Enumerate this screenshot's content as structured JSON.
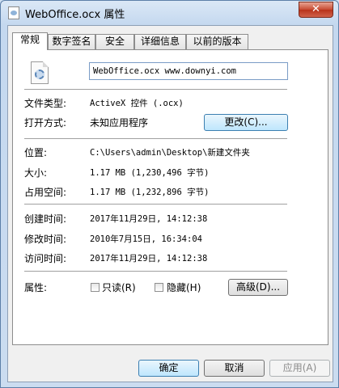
{
  "window": {
    "title": "WebOffice.ocx 属性",
    "close_label": "✕"
  },
  "tabs": [
    {
      "label": "常规",
      "active": true
    },
    {
      "label": "数字签名",
      "active": false
    },
    {
      "label": "安全",
      "active": false
    },
    {
      "label": "详细信息",
      "active": false
    },
    {
      "label": "以前的版本",
      "active": false
    }
  ],
  "general": {
    "file_name": "WebOffice.ocx www.downyi.com",
    "file_type_label": "文件类型:",
    "file_type_value": "ActiveX 控件 (.ocx)",
    "open_with_label": "打开方式:",
    "open_with_value": "未知应用程序",
    "change_button": "更改(C)...",
    "location_label": "位置:",
    "location_value": "C:\\Users\\admin\\Desktop\\新建文件夹",
    "size_label": "大小:",
    "size_value": "1.17 MB (1,230,496 字节)",
    "size_on_disk_label": "占用空间:",
    "size_on_disk_value": "1.17 MB (1,232,896 字节)",
    "created_label": "创建时间:",
    "created_value": "2017年11月29日, 14:12:38",
    "modified_label": "修改时间:",
    "modified_value": "2010年7月15日, 16:34:04",
    "accessed_label": "访问时间:",
    "accessed_value": "2017年11月29日, 14:12:38",
    "attributes_label": "属性:",
    "readonly_label": "只读(R)",
    "hidden_label": "隐藏(H)",
    "advanced_button": "高级(D)..."
  },
  "footer": {
    "ok_button": "确定",
    "cancel_button": "取消",
    "apply_button": "应用(A)"
  },
  "colors": {
    "accent_border": "#3c7fb1",
    "window_frame": "#5c7fa8"
  }
}
